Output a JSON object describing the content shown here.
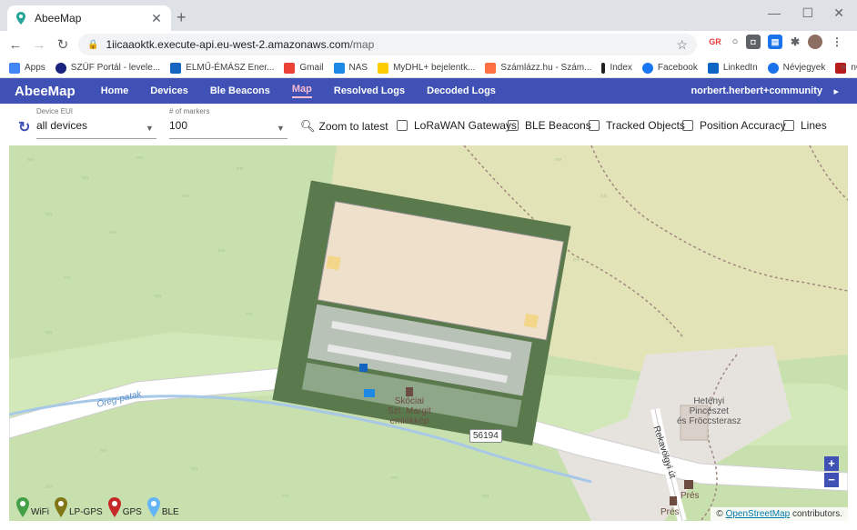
{
  "browser": {
    "tab_title": "AbeeMap",
    "url_host": "1iicaaoktk.execute-api.eu-west-2.amazonaws.com",
    "url_path": "/map",
    "bookmarks": [
      {
        "label": "Apps",
        "color": "#4285f4"
      },
      {
        "label": "SZÜF Portál - levele...",
        "color": "#1a237e"
      },
      {
        "label": "ELMŰ-ÉMÁSZ Ener...",
        "color": "#1565c0"
      },
      {
        "label": "Gmail",
        "color": "#ea4335"
      },
      {
        "label": "NAS",
        "color": "#1e88e5"
      },
      {
        "label": "MyDHL+ bejelentk...",
        "color": "#ffcc00"
      },
      {
        "label": "Számlázz.hu - Szám...",
        "color": "#ff7043"
      },
      {
        "label": "Index",
        "color": "#212121"
      },
      {
        "label": "Facebook",
        "color": "#1877f2"
      },
      {
        "label": "LinkedIn",
        "color": "#0a66c2"
      },
      {
        "label": "Névjegyek",
        "color": "#1a73e8"
      },
      {
        "label": "nCore",
        "color": "#b71c1c"
      }
    ],
    "more": "»"
  },
  "app": {
    "brand": "AbeeMap",
    "nav": [
      {
        "label": "Home",
        "active": false
      },
      {
        "label": "Devices",
        "active": false
      },
      {
        "label": "Ble Beacons",
        "active": false
      },
      {
        "label": "Map",
        "active": true
      },
      {
        "label": "Resolved Logs",
        "active": false
      },
      {
        "label": "Decoded Logs",
        "active": false
      }
    ],
    "user": "norbert.herbert+community",
    "accent": "#3f51b5"
  },
  "filters": {
    "device_label": "Device EUI",
    "device_value": "all devices",
    "markers_label": "# of markers",
    "markers_value": "100",
    "zoom_latest": "Zoom to latest",
    "checkboxes": [
      {
        "label": "LoRaWAN Gateways",
        "checked": false
      },
      {
        "label": "BLE Beacons",
        "checked": false
      },
      {
        "label": "Tracked Objects",
        "checked": false
      },
      {
        "label": "Position Accuracy",
        "checked": false
      },
      {
        "label": "Lines",
        "checked": false
      }
    ]
  },
  "map": {
    "labels": {
      "memorial": "Skóciai\nSzt. Margit\nemlékkép",
      "winery": "Hetényi\nPincészet\nés Fröccsterasz",
      "road_number": "56194",
      "street": "Rekavölgyi út",
      "stream": "Öreg-patak",
      "press1": "Prés",
      "press2": "Prés"
    },
    "zoom_in": "+",
    "zoom_out": "−",
    "attribution_prefix": "©",
    "attribution_link": "OpenStreetMap",
    "attribution_suffix": "contributors.",
    "legend": [
      {
        "label": "WiFi",
        "color": "#43a047"
      },
      {
        "label": "LP-GPS",
        "color": "#827717"
      },
      {
        "label": "GPS",
        "color": "#c62828"
      },
      {
        "label": "BLE",
        "color": "#64b5f6"
      }
    ]
  }
}
